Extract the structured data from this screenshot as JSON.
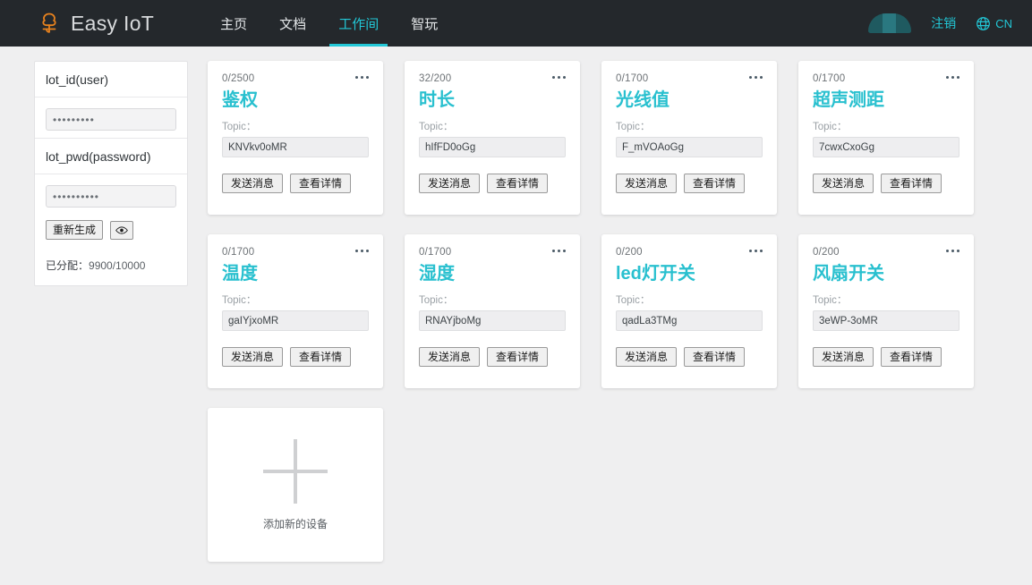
{
  "header": {
    "brand": "Easy IoT",
    "logo_icon": "tree-logo-icon",
    "nav": [
      {
        "label": "主页",
        "active": false
      },
      {
        "label": "文档",
        "active": false
      },
      {
        "label": "工作间",
        "active": true
      },
      {
        "label": "智玩",
        "active": false
      }
    ],
    "avatar_icon": "user-avatar",
    "logout_label": "注销",
    "language_icon": "globe-icon",
    "language_label": "CN",
    "accent_color": "#22c7d6",
    "bar_color": "#24282c",
    "logo_color": "#e8821e"
  },
  "credentials": {
    "id_label": "lot_id(user)",
    "id_value": "•••••••••",
    "pwd_label": "lot_pwd(password)",
    "pwd_value": "••••••••••",
    "regenerate_label": "重新生成",
    "eye_icon": "eye-icon",
    "alloc_label": "已分配：",
    "alloc_value": "9900/10000"
  },
  "cards": [
    {
      "count": "0/2500",
      "title": "鉴权",
      "topic_label": "Topic：",
      "topic": "KNVkv0oMR",
      "send_label": "发送消息",
      "detail_label": "查看详情",
      "menu_icon": "more-options-icon"
    },
    {
      "count": "32/200",
      "title": "时长",
      "topic_label": "Topic：",
      "topic": "hIfFD0oGg",
      "send_label": "发送消息",
      "detail_label": "查看详情",
      "menu_icon": "more-options-icon"
    },
    {
      "count": "0/1700",
      "title": "光线值",
      "topic_label": "Topic：",
      "topic": "F_mVOAoGg",
      "send_label": "发送消息",
      "detail_label": "查看详情",
      "menu_icon": "more-options-icon"
    },
    {
      "count": "0/1700",
      "title": "超声测距",
      "topic_label": "Topic：",
      "topic": "7cwxCxoGg",
      "send_label": "发送消息",
      "detail_label": "查看详情",
      "menu_icon": "more-options-icon"
    },
    {
      "count": "0/1700",
      "title": "温度",
      "topic_label": "Topic：",
      "topic": "gaIYjxoMR",
      "send_label": "发送消息",
      "detail_label": "查看详情",
      "menu_icon": "more-options-icon"
    },
    {
      "count": "0/1700",
      "title": "湿度",
      "topic_label": "Topic：",
      "topic": "RNAYjboMg",
      "send_label": "发送消息",
      "detail_label": "查看详情",
      "menu_icon": "more-options-icon"
    },
    {
      "count": "0/200",
      "title": "led灯开关",
      "topic_label": "Topic：",
      "topic": "qadLa3TMg",
      "send_label": "发送消息",
      "detail_label": "查看详情",
      "menu_icon": "more-options-icon"
    },
    {
      "count": "0/200",
      "title": "风扇开关",
      "topic_label": "Topic：",
      "topic": "3eWP-3oMR",
      "send_label": "发送消息",
      "detail_label": "查看详情",
      "menu_icon": "more-options-icon"
    }
  ],
  "add_card": {
    "plus_icon": "plus-icon",
    "label": "添加新的设备"
  }
}
